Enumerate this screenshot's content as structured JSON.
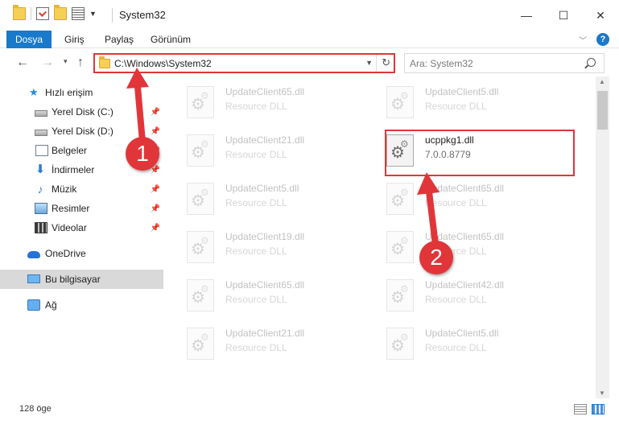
{
  "window": {
    "title": "System32",
    "minimize_label": "—",
    "maximize_label": "☐",
    "close_label": "✕"
  },
  "ribbon": {
    "tabs": [
      {
        "label": "Dosya",
        "active": true
      },
      {
        "label": "Giriş"
      },
      {
        "label": "Paylaş"
      },
      {
        "label": "Görünüm"
      }
    ],
    "help_label": "?"
  },
  "nav": {
    "address": "C:\\Windows\\System32",
    "search_placeholder": "Ara: System32"
  },
  "sidebar": {
    "items": [
      {
        "label": "Hızlı erişim",
        "icon": "star-icon"
      },
      {
        "label": "Yerel Disk (C:)",
        "icon": "disk-icon",
        "pinned": true
      },
      {
        "label": "Yerel Disk (D:)",
        "icon": "disk-icon",
        "pinned": true
      },
      {
        "label": "Belgeler",
        "icon": "documents-icon",
        "pinned": true
      },
      {
        "label": "İndirmeler",
        "icon": "downloads-icon",
        "pinned": true
      },
      {
        "label": "Müzik",
        "icon": "music-icon",
        "pinned": true
      },
      {
        "label": "Resimler",
        "icon": "pictures-icon",
        "pinned": true
      },
      {
        "label": "Videolar",
        "icon": "videos-icon",
        "pinned": true
      },
      {
        "label": "OneDrive",
        "icon": "cloud-icon"
      },
      {
        "label": "Bu bilgisayar",
        "icon": "computer-icon",
        "selected": true
      },
      {
        "label": "Ağ",
        "icon": "network-icon"
      }
    ]
  },
  "files": {
    "left_column": [
      {
        "name": "UpdateClient65.dll",
        "type": "Resource DLL"
      },
      {
        "name": "UpdateClient21.dll",
        "type": "Resource DLL"
      },
      {
        "name": "UpdateClient5.dll",
        "type": "Resource DLL"
      },
      {
        "name": "UpdateClient19.dll",
        "type": "Resource DLL"
      },
      {
        "name": "UpdateClient65.dll",
        "type": "Resource DLL"
      },
      {
        "name": "UpdateClient21.dll",
        "type": "Resource DLL"
      }
    ],
    "right_column": [
      {
        "name": "UpdateClient5.dll",
        "type": "Resource DLL"
      },
      {
        "name": "ucppkg1.dll",
        "type": "7.0.0.8779",
        "highlighted": true
      },
      {
        "name": "UpdateClient65.dll",
        "type": "Resource DLL"
      },
      {
        "name": "UpdateClient65.dll",
        "type": "Resource DLL"
      },
      {
        "name": "UpdateClient42.dll",
        "type": "Resource DLL"
      },
      {
        "name": "UpdateClient5.dll",
        "type": "Resource DLL"
      }
    ]
  },
  "status": {
    "item_count": "128 öge"
  },
  "annotations": {
    "step1": "1",
    "step2": "2",
    "color": "#e0363a"
  },
  "colors": {
    "accent": "#1979ca",
    "highlight": "#e0363a"
  }
}
